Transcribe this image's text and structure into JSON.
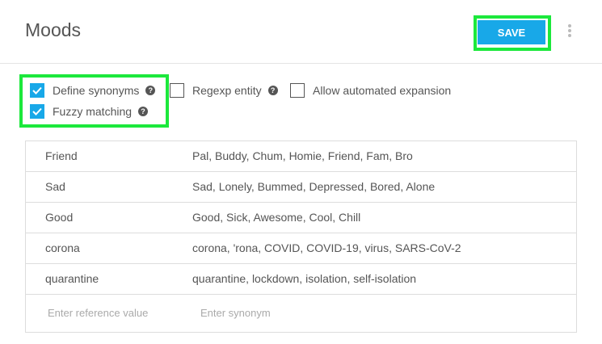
{
  "header": {
    "title": "Moods",
    "save_label": "SAVE"
  },
  "options": {
    "define_synonyms": {
      "label": "Define synonyms",
      "checked": true
    },
    "regexp_entity": {
      "label": "Regexp entity",
      "checked": false
    },
    "allow_expansion": {
      "label": "Allow automated expansion",
      "checked": false
    },
    "fuzzy_matching": {
      "label": "Fuzzy matching",
      "checked": true
    }
  },
  "entries": [
    {
      "ref": "Friend",
      "synonyms": "Pal, Buddy, Chum, Homie, Friend, Fam, Bro"
    },
    {
      "ref": "Sad",
      "synonyms": "Sad, Lonely, Bummed, Depressed, Bored, Alone"
    },
    {
      "ref": "Good",
      "synonyms": "Good, Sick, Awesome, Cool, Chill"
    },
    {
      "ref": "corona",
      "synonyms": "corona, 'rona, COVID, COVID-19, virus, SARS-CoV-2"
    },
    {
      "ref": "quarantine",
      "synonyms": "quarantine, lockdown, isolation, self-isolation"
    }
  ],
  "inputs": {
    "ref_placeholder": "Enter reference value",
    "syn_placeholder": "Enter synonym"
  },
  "colors": {
    "accent": "#18a8e8",
    "highlight": "#1ce83c"
  }
}
